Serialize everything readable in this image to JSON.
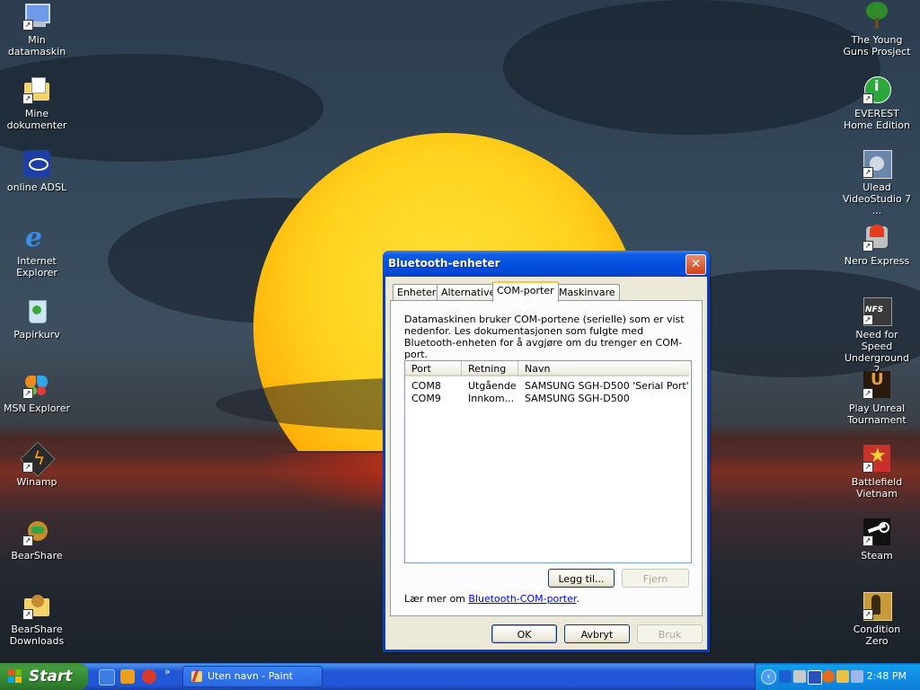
{
  "desktop_icons_left": [
    {
      "label": "Min datamaskin",
      "icon": "computer-icon"
    },
    {
      "label": "Mine dokumenter",
      "icon": "documents-folder-icon"
    },
    {
      "label": "online ADSL",
      "icon": "adsl-icon"
    },
    {
      "label": "Internet Explorer",
      "icon": "internet-explorer-icon"
    },
    {
      "label": "Papirkurv",
      "icon": "recycle-bin-icon"
    },
    {
      "label": "MSN Explorer",
      "icon": "msn-butterfly-icon"
    },
    {
      "label": "Winamp",
      "icon": "winamp-icon"
    },
    {
      "label": "BearShare",
      "icon": "bearshare-icon"
    },
    {
      "label": "BearShare Downloads",
      "icon": "bearshare-folder-icon"
    }
  ],
  "desktop_icons_right": [
    {
      "label": "The Young Guns Prosject",
      "icon": "tree-icon"
    },
    {
      "label": "EVEREST Home Edition",
      "icon": "everest-icon"
    },
    {
      "label": "Ulead VideoStudio 7 ...",
      "icon": "videostudio-icon"
    },
    {
      "label": "Nero Express",
      "icon": "nero-icon"
    },
    {
      "label": "Need for Speed Underground 2",
      "icon": "nfs-icon"
    },
    {
      "label": "Play Unreal Tournament",
      "icon": "unreal-icon"
    },
    {
      "label": "Battlefield Vietnam",
      "icon": "battlefield-star-icon"
    },
    {
      "label": "Steam",
      "icon": "steam-icon"
    },
    {
      "label": "Condition Zero",
      "icon": "condition-zero-icon"
    }
  ],
  "dialog": {
    "title": "Bluetooth-enheter",
    "close_glyph": "✕",
    "tabs": [
      {
        "label": "Enheter",
        "active": false
      },
      {
        "label": "Alternativer",
        "active": false
      },
      {
        "label": "COM-porter",
        "active": true
      },
      {
        "label": "Maskinvare",
        "active": false
      }
    ],
    "description": "Datamaskinen bruker COM-portene (serielle) som er vist nedenfor. Les dokumentasjonen som fulgte med Bluetooth-enheten for å avgjøre om du trenger en COM-port.",
    "columns": [
      "Port",
      "Retning",
      "Navn"
    ],
    "rows": [
      {
        "port": "COM8",
        "direction": "Utgående",
        "name": "SAMSUNG SGH-D500 'Serial Port'"
      },
      {
        "port": "COM9",
        "direction": "Innkom...",
        "name": "SAMSUNG SGH-D500"
      }
    ],
    "add_button": "Legg til...",
    "remove_button": "Fjern",
    "learn_prefix": "Lær mer om ",
    "learn_link": "Bluetooth-COM-porter",
    "learn_suffix": ".",
    "ok_button": "OK",
    "cancel_button": "Avbryt",
    "apply_button": "Bruk"
  },
  "taskbar": {
    "start_label": "Start",
    "quicklaunch": [
      "quicklaunch-1-icon",
      "quicklaunch-2-icon",
      "quicklaunch-3-icon"
    ],
    "overflow_glyph": "»",
    "task_label": "Uten navn - Paint",
    "tray_expand_glyph": "‹",
    "clock": "2:48 PM"
  },
  "colors": {
    "titlebar": "#0350e0",
    "dialog_face": "#ece9d8",
    "taskbar": "#2157d7",
    "start": "#3f9b3b",
    "link": "#0000ff"
  }
}
